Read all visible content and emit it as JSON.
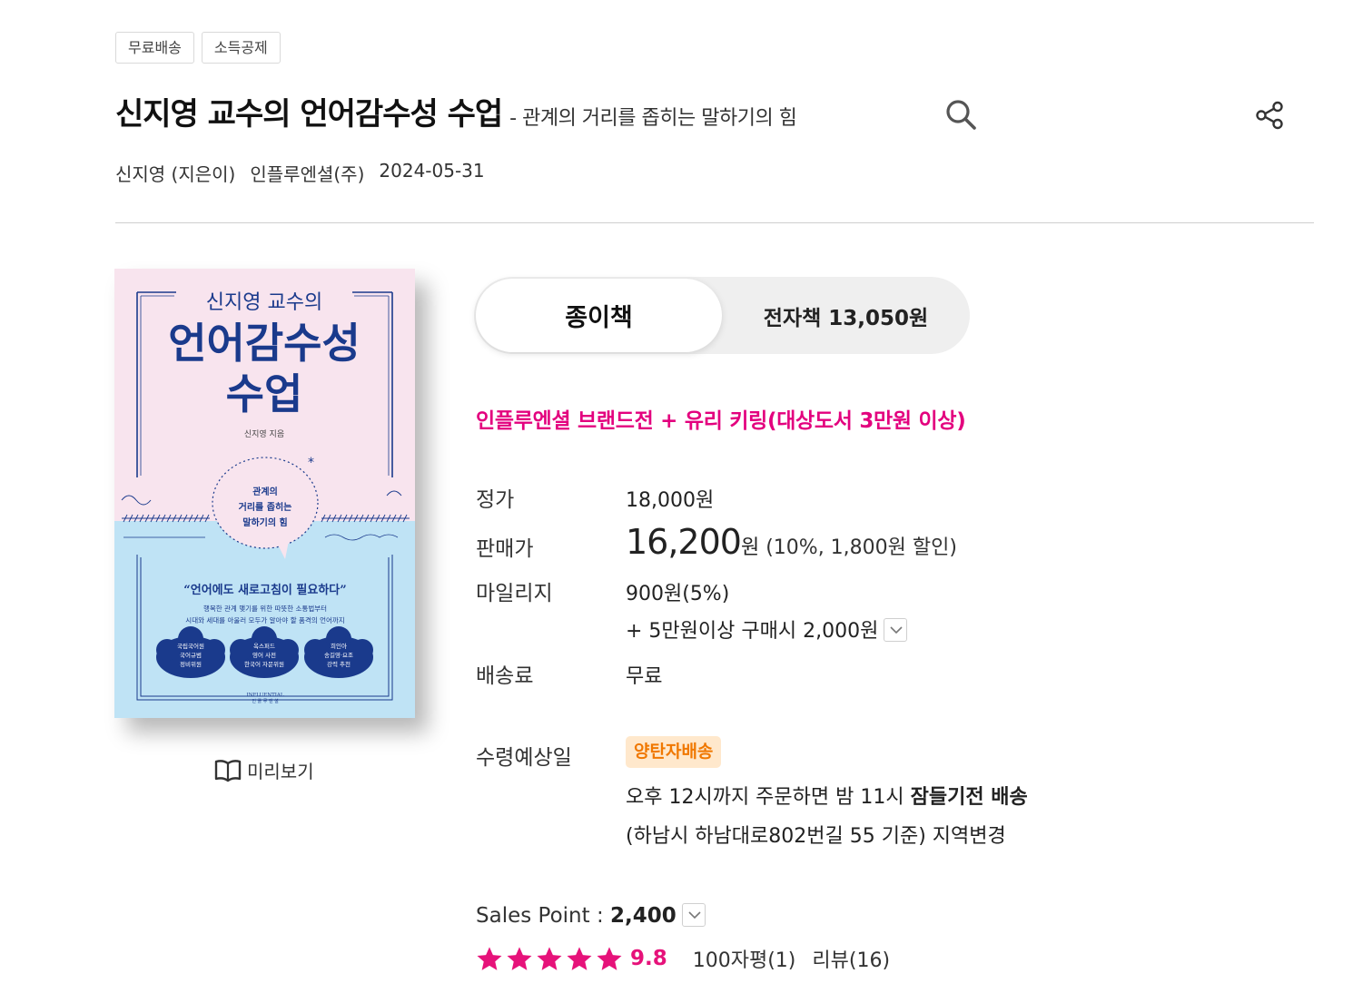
{
  "tags": [
    "무료배송",
    "소득공제"
  ],
  "title": {
    "main": "신지영 교수의 언어감수성 수업",
    "sub": "- 관계의 거리를 좁히는 말하기의 힘"
  },
  "meta": {
    "author": "신지영 (지은이)",
    "publisher": "인플루엔셜(주)",
    "date": "2024-05-31"
  },
  "cover": {
    "top_small": "신지영 교수의",
    "title_line1": "언어감수성",
    "title_line2": "수업",
    "author_small": "신지영 지음",
    "bubble_line1": "관계의",
    "bubble_line2": "거리를 좁히는",
    "bubble_line3": "말하기의 힘",
    "quote": "“언어에도 새로고침이 필요하다”",
    "desc_line1": "행복한 관계 맺기를 위한 따뜻한 소통법부터",
    "desc_line2": "시대와 세대를 아울러 모두가 알아야 할 품격의 언어까지",
    "badge1_l1": "국립국어원",
    "badge1_l2": "국어규범",
    "badge1_l3": "정비위원",
    "badge2_l1": "옥스퍼드",
    "badge2_l2": "영어 사전",
    "badge2_l3": "한국어 자문위원",
    "badge3_l1": "희인아",
    "badge3_l2": "송길영·요조",
    "badge3_l3": "강력 추천",
    "publisher_logo_en": "INFLUENTIAL",
    "publisher_logo_ko": "인 플 루 엔 셜"
  },
  "preview_label": "미리보기",
  "format": {
    "paper_label": "종이책",
    "ebook_label": "전자책 13,050원"
  },
  "promo": "인플루엔셜 브랜드전 + 유리 키링(대상도서 3만원 이상)",
  "pricing": {
    "list_label": "정가",
    "list_value": "18,000원",
    "sale_label": "판매가",
    "sale_price": "16,200",
    "sale_unit": "원",
    "sale_discount": "(10%, 1,800원 할인)",
    "mileage_label": "마일리지",
    "mileage_value": "900원(5%)",
    "mileage_extra": "+ 5만원이상 구매시 2,000원",
    "shipping_label": "배송료",
    "shipping_value": "무료"
  },
  "delivery": {
    "label": "수령예상일",
    "badge": "양탄자배송",
    "line_prefix": "오후 12시까지 주문하면 밤 11시 ",
    "line_bold": "잠들기전 배송",
    "location": "(하남시 하남대로802번길 55 기준) ",
    "change_link": "지역변경"
  },
  "sales": {
    "label": "Sales Point : ",
    "value": "2,400"
  },
  "rating": {
    "stars": 5,
    "score": "9.8",
    "short_reviews": "100자평(1)",
    "reviews": "리뷰(16)"
  },
  "colors": {
    "accent_pink": "#e3007e",
    "star_pink": "#e6127a",
    "badge_orange": "#f07800",
    "badge_bg": "#ffe8cc",
    "cover_pink": "#f8e4ee",
    "cover_blue": "#bfe3f5",
    "cover_navy": "#1a3a8c"
  },
  "icons": {
    "search": "search-icon",
    "share": "share-icon",
    "book": "open-book-icon",
    "dropdown": "chevron-down-icon",
    "star": "star-icon"
  }
}
